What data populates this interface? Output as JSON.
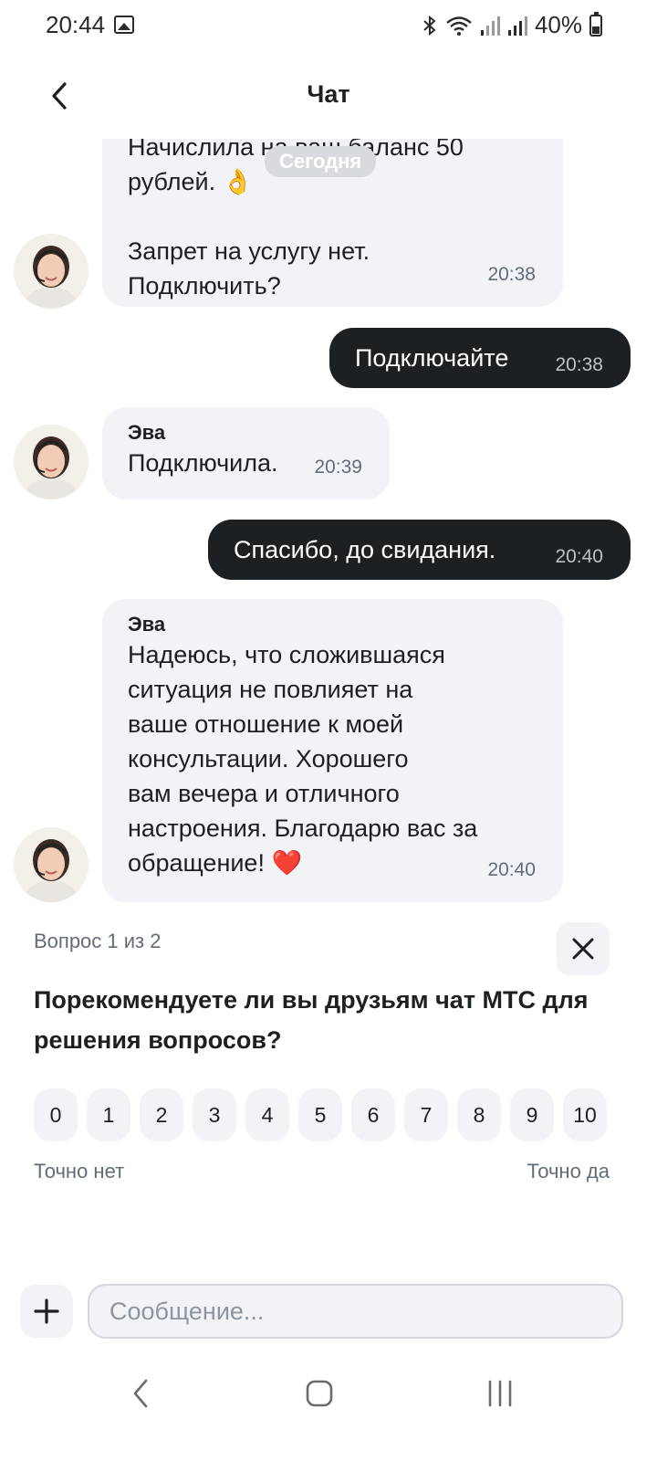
{
  "status_bar": {
    "time": "20:44",
    "battery": "40%",
    "icons": [
      "image-icon",
      "bluetooth-icon",
      "wifi-icon",
      "signal-icon",
      "signal-icon",
      "battery-icon"
    ]
  },
  "header": {
    "title": "Чат",
    "back_icon": "chevron-left-icon"
  },
  "chat": {
    "date_pill": "Сегодня",
    "messages": [
      {
        "direction": "in",
        "sender": "",
        "text_partial": "Начислила на ваш баланс 50",
        "text": "рублей. 👌\n\nЗапрет на услугу нет.\nПодключить?",
        "time": "20:38"
      },
      {
        "direction": "out",
        "text": "Подключайте",
        "time": "20:38"
      },
      {
        "direction": "in",
        "sender": "Эва",
        "text": "Подключила.",
        "time": "20:39"
      },
      {
        "direction": "out",
        "text": "Спасибо,  до свидания.",
        "time": "20:40"
      },
      {
        "direction": "in",
        "sender": "Эва",
        "text": "Надеюсь, что сложившаяся\nситуация не повлияет на\nваше отношение к моей\nконсультации. Хорошего\nвам вечера и отличного\nнастроения. Благодарю вас за\nобращение! ❤️",
        "time": "20:40"
      }
    ]
  },
  "survey": {
    "counter": "Вопрос 1 из 2",
    "question": "Порекомендуете ли вы друзьям чат МТС для решения вопросов?",
    "scale": [
      "0",
      "1",
      "2",
      "3",
      "4",
      "5",
      "6",
      "7",
      "8",
      "9",
      "10"
    ],
    "min_label": "Точно нет",
    "max_label": "Точно да",
    "close_icon": "close-icon"
  },
  "composer": {
    "placeholder": "Сообщение...",
    "value": "",
    "attach_icon": "plus-icon"
  },
  "nav_bar": {
    "icons": [
      "back-icon",
      "home-icon",
      "recents-icon"
    ]
  },
  "colors": {
    "incoming_bubble": "#f2f3f7",
    "outgoing_bubble": "#1d2023",
    "text_primary": "#1d2023",
    "text_secondary": "#626c77"
  }
}
